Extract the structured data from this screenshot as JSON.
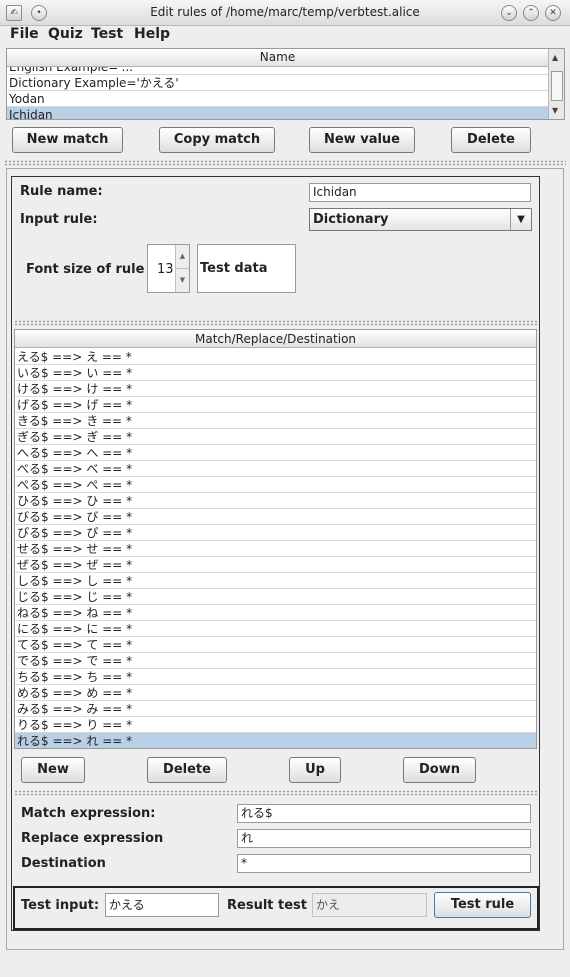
{
  "window": {
    "title": "Edit rules of /home/marc/temp/verbtest.alice"
  },
  "menu": {
    "items": [
      "File",
      "Quiz",
      "Test",
      "Help"
    ]
  },
  "list": {
    "header": "Name",
    "rows": [
      "English  Example='...'",
      "Dictionary  Example='かえる'",
      "Yodan",
      "Ichidan"
    ],
    "selected_index": 3
  },
  "list_buttons": {
    "new_match": "New match",
    "copy_match": "Copy match",
    "new_value": "New value",
    "delete": "Delete"
  },
  "rule": {
    "name_label": "Rule name:",
    "name_value": "Ichidan",
    "input_label": "Input rule:",
    "input_value": "Dictionary",
    "font_label": "Font size of rule",
    "font_value": "13",
    "test_data": "Test data"
  },
  "match_table": {
    "header": "Match/Replace/Destination",
    "rows": [
      "える$ ==> え == *",
      "いる$ ==> い == *",
      "ける$ ==> け == *",
      "げる$ ==> げ == *",
      "きる$ ==> き == *",
      "ぎる$ ==> ぎ == *",
      "へる$ ==> へ == *",
      "べる$ ==> べ == *",
      "ぺる$ ==> ぺ == *",
      "ひる$ ==> ひ == *",
      "びる$ ==> び == *",
      "ぴる$ ==> ぴ == *",
      "せる$ ==> せ == *",
      "ぜる$ ==> ぜ == *",
      "しる$ ==> し == *",
      "じる$ ==> じ == *",
      "ねる$ ==> ね == *",
      "にる$ ==> に == *",
      "てる$ ==> て == *",
      "でる$ ==> で == *",
      "ちる$ ==> ち == *",
      "める$ ==> め == *",
      "みる$ ==> み == *",
      "りる$ ==> り == *",
      "れる$ ==> れ == *"
    ],
    "selected_index": 24
  },
  "match_buttons": {
    "new": "New",
    "delete": "Delete",
    "up": "Up",
    "down": "Down"
  },
  "expr": {
    "match_label": "Match expression:",
    "match_value": "れる$",
    "replace_label": "Replace expression",
    "replace_value": "れ",
    "dest_label": "Destination",
    "dest_value": "*"
  },
  "test": {
    "input_label": "Test input:",
    "input_value": "かえる",
    "result_label": "Result test",
    "result_value": "かえ",
    "button": "Test rule"
  }
}
